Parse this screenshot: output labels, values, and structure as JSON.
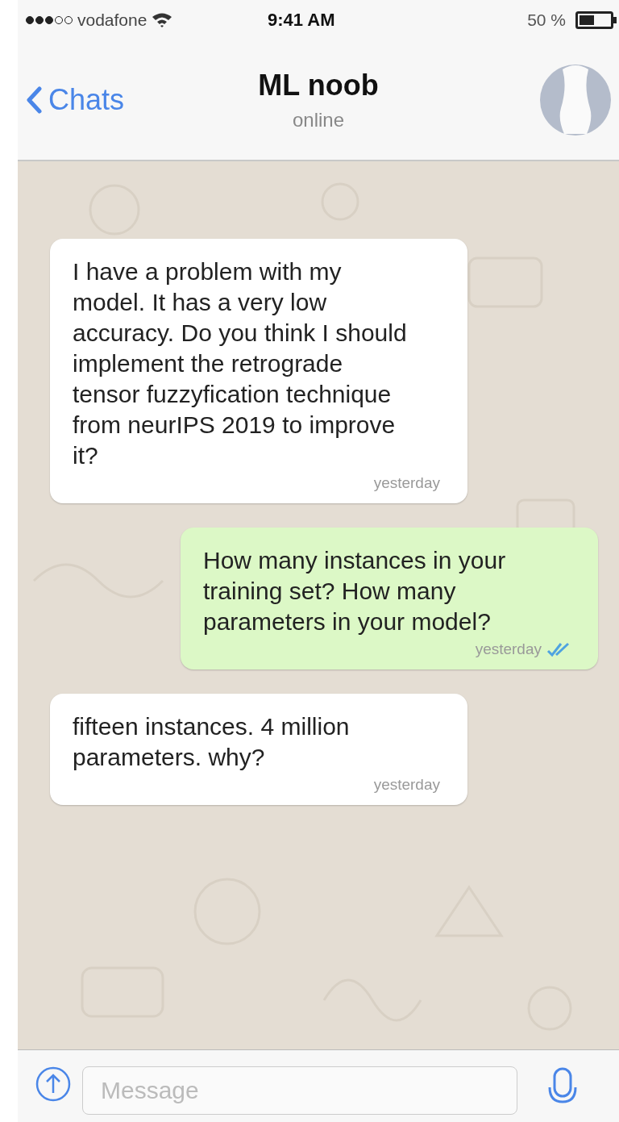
{
  "status_bar": {
    "signal_bars": [
      {
        "filled": true
      },
      {
        "filled": true
      },
      {
        "filled": true
      },
      {
        "filled": false
      },
      {
        "filled": false
      }
    ],
    "carrier": "vodafone",
    "time": "9:41 AM",
    "battery": "50 %"
  },
  "header": {
    "back": "Chats",
    "title": "ML noob",
    "subtitle": "online"
  },
  "messages": [
    {
      "kind": "incoming",
      "text": "I have a problem with my model. It has a very low accuracy. Do you think I should implement the retrograde tensor fuzzyfication technique from neurIPS 2019 to improve it?",
      "time": "yesterday",
      "read": false
    },
    {
      "kind": "outgoing",
      "text": "How many instances in your training set? How many parameters in your model?",
      "time": "yesterday",
      "read": true
    },
    {
      "kind": "incoming",
      "text": "fifteen instances. 4 million parameters. why?",
      "time": "yesterday",
      "read": false
    }
  ],
  "composer": {
    "placeholder": "Message"
  }
}
